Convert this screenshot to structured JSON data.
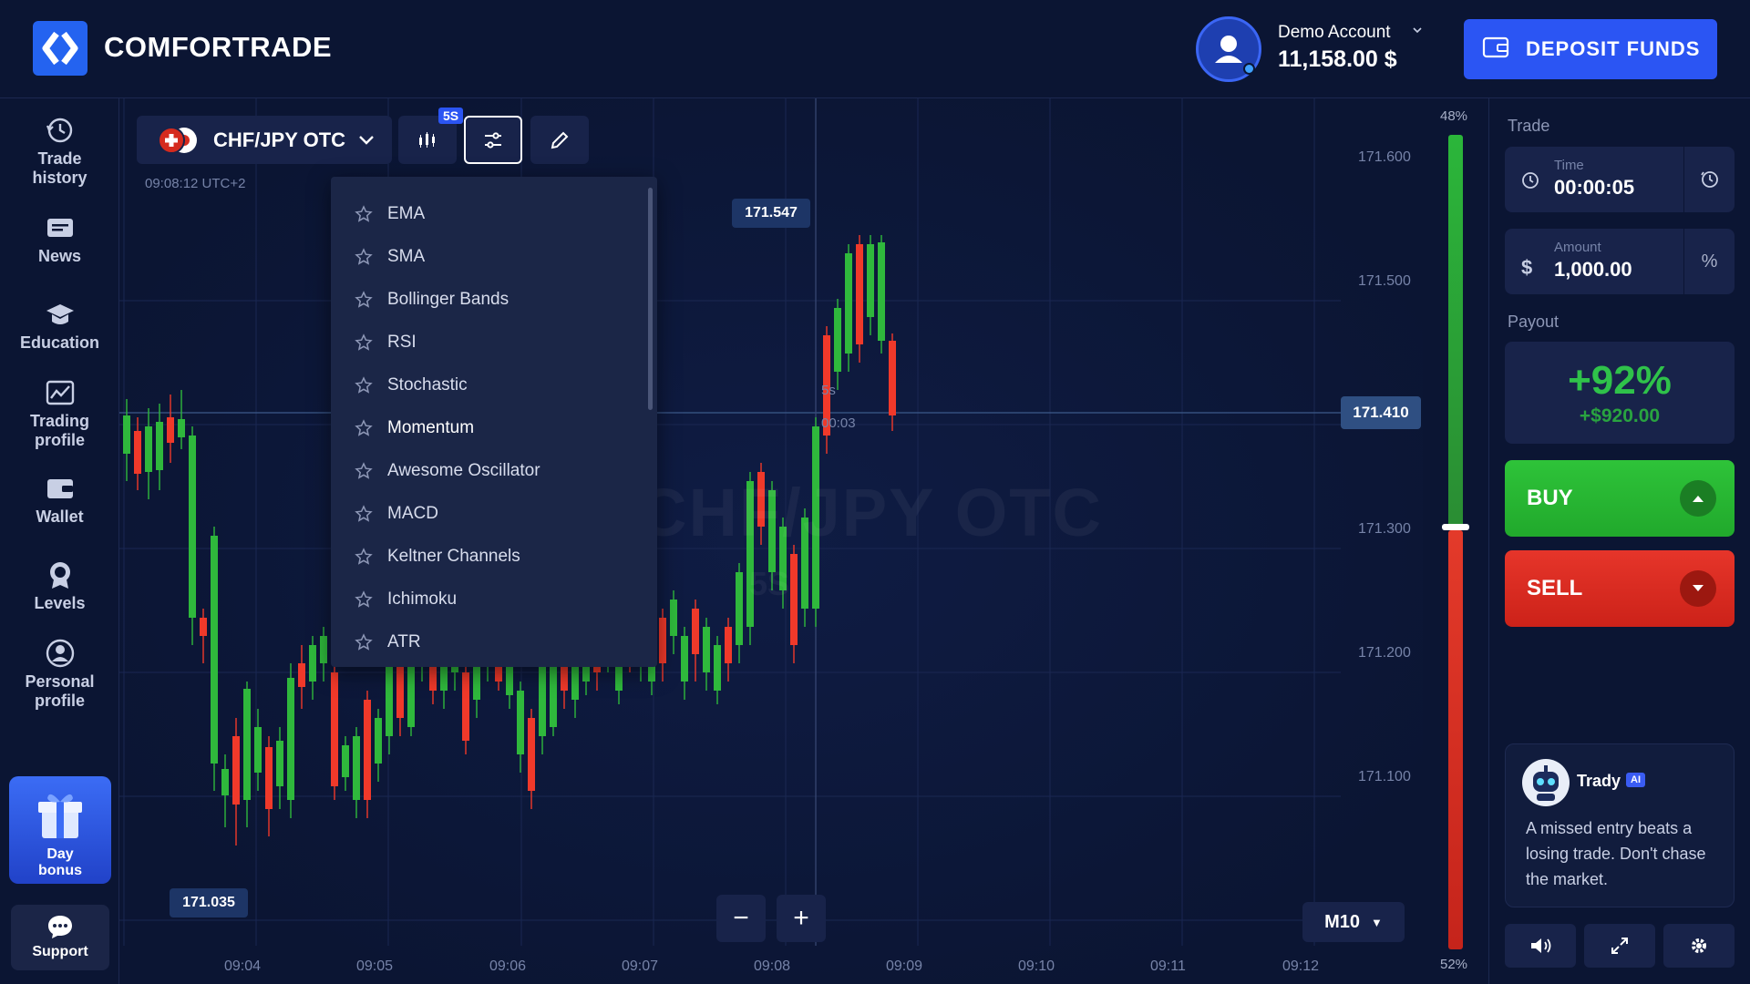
{
  "brand": {
    "name": "COMFORTRADE",
    "accent": "#2b55f3"
  },
  "account": {
    "label": "Demo Account",
    "balance": "11,158.00 $"
  },
  "deposit": {
    "label": "DEPOSIT FUNDS"
  },
  "sidebar": {
    "items": [
      {
        "l1": "Trade",
        "l2": "history",
        "icon": "history-icon"
      },
      {
        "l1": "News",
        "l2": "",
        "icon": "news-icon"
      },
      {
        "l1": "Education",
        "l2": "",
        "icon": "education-icon"
      },
      {
        "l1": "Trading",
        "l2": "profile",
        "icon": "chart-icon"
      },
      {
        "l1": "Wallet",
        "l2": "",
        "icon": "wallet-icon"
      },
      {
        "l1": "Levels",
        "l2": "",
        "icon": "medal-icon"
      },
      {
        "l1": "Personal",
        "l2": "profile",
        "icon": "user-icon"
      }
    ],
    "day_bonus": {
      "l1": "Day",
      "l2": "bonus"
    },
    "support": "Support"
  },
  "chart": {
    "pair": "CHF/JPY OTC",
    "badge": "5S",
    "clock": "09:08:12 UTC+2",
    "watermark": "CHF/JPY OTC",
    "watermark_sub": "5S",
    "high_label": "171.547",
    "low_label": "171.035",
    "current_price": "171.410",
    "expiry_interval": "5s",
    "expiry_countdown": "00:03",
    "y_ticks": [
      "171.600",
      "171.500",
      "171.300",
      "171.200",
      "171.100"
    ],
    "x_ticks": [
      "09:04",
      "09:05",
      "09:06",
      "09:07",
      "09:08",
      "09:09",
      "09:10",
      "09:11",
      "09:12"
    ],
    "timeframe": "M10",
    "zoom_out": "−",
    "zoom_in": "+",
    "bull_color": "#2fb83c",
    "bear_color": "#f0392a"
  },
  "indicators": {
    "items": [
      "EMA",
      "SMA",
      "Bollinger Bands",
      "RSI",
      "Stochastic",
      "Momentum",
      "Awesome Oscillator",
      "MACD",
      "Keltner Channels",
      "Ichimoku",
      "ATR"
    ],
    "highlighted": "Momentum"
  },
  "sentiment": {
    "up_pct": "48%",
    "down_pct": "52%",
    "up_fraction": 0.48
  },
  "panel": {
    "trade_title": "Trade",
    "time": {
      "label": "Time",
      "value": "00:00:05"
    },
    "amount": {
      "label": "Amount",
      "currency": "$",
      "value": "1,000.00",
      "mode": "%"
    },
    "payout_title": "Payout",
    "payout_pct": "+92%",
    "payout_amount": "+$920.00",
    "buy": "BUY",
    "sell": "SELL"
  },
  "trady": {
    "name": "Trady",
    "badge": "AI",
    "message": "A missed entry beats a losing trade. Don't chase the market."
  }
}
